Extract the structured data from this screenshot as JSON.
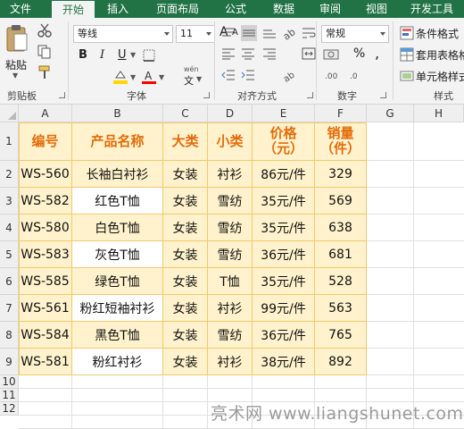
{
  "ribbon_tabs": [
    "文件",
    "开始",
    "插入",
    "页面布局",
    "公式",
    "数据",
    "审阅",
    "视图",
    "开发工具"
  ],
  "active_tab": "开始",
  "clipboard": {
    "paste_label": "粘贴",
    "group_label": "剪贴板"
  },
  "font": {
    "name": "等线",
    "size": "11",
    "bold": "B",
    "italic": "I",
    "underline": "U",
    "wen_label": "wén",
    "wen_char": "文",
    "group_label": "字体",
    "fill_color": "#ffd700",
    "font_color": "#ff0000",
    "grow_label": "A",
    "shrink_label": "A"
  },
  "alignment": {
    "group_label": "对齐方式"
  },
  "number": {
    "format": "常规",
    "percent": "%",
    "comma": ",",
    "group_label": "数字"
  },
  "styles": {
    "conditional_format": "条件格式",
    "table_format": "套用表格格",
    "cell_style": "单元格样式",
    "group_label": "样式"
  },
  "columns": [
    "A",
    "B",
    "C",
    "D",
    "E",
    "F",
    "G",
    "H"
  ],
  "rows": [
    "1",
    "2",
    "3",
    "4",
    "5",
    "6",
    "7",
    "8",
    "9",
    "10",
    "11",
    "12"
  ],
  "table": {
    "headers": [
      "编号",
      "产品名称",
      "大类",
      "小类",
      "价格\n（元）",
      "销量\n（件）"
    ],
    "rows": [
      [
        "WS-560",
        "长袖白衬衫",
        "女装",
        "衬衫",
        "86元/件",
        "329"
      ],
      [
        "WS-582",
        "红色T恤",
        "女装",
        "雪纺",
        "35元/件",
        "569"
      ],
      [
        "WS-580",
        "白色T恤",
        "女装",
        "雪纺",
        "35元/件",
        "638"
      ],
      [
        "WS-583",
        "灰色T恤",
        "女装",
        "雪纺",
        "36元/件",
        "681"
      ],
      [
        "WS-585",
        "绿色T恤",
        "女装",
        "T恤",
        "35元/件",
        "528"
      ],
      [
        "WS-561",
        "粉红短袖衬衫",
        "女装",
        "衬衫",
        "99元/件",
        "563"
      ],
      [
        "WS-584",
        "黑色T恤",
        "女装",
        "雪纺",
        "36元/件",
        "765"
      ],
      [
        "WS-581",
        "粉红衬衫",
        "女装",
        "衬衫",
        "38元/件",
        "892"
      ]
    ],
    "highlighted_rows": [
      0,
      2,
      4,
      6
    ]
  },
  "watermark": "亮术网 www.liangshunet.com",
  "colors": {
    "ribbon_green": "#217346",
    "header_text": "#e36c0a",
    "highlight_fill": "#fff2cc"
  }
}
